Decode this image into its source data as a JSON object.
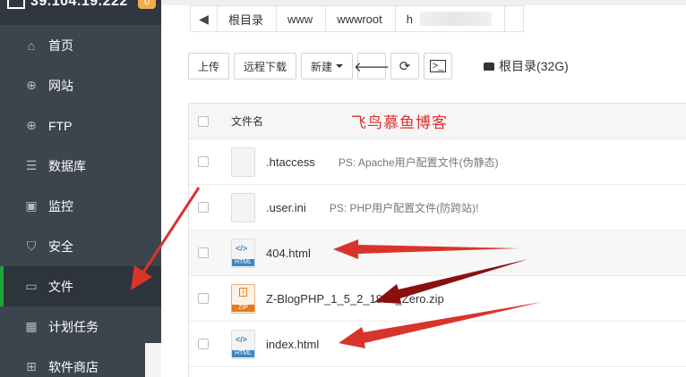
{
  "sidebar": {
    "ip": "39.104.19.222",
    "badge": "0",
    "items": [
      {
        "label": "首页",
        "icon": "⌂"
      },
      {
        "label": "网站",
        "icon": "⊕"
      },
      {
        "label": "FTP",
        "icon": "⊕"
      },
      {
        "label": "数据库",
        "icon": "☰"
      },
      {
        "label": "监控",
        "icon": "▣"
      },
      {
        "label": "安全",
        "icon": "⛉"
      },
      {
        "label": "文件",
        "icon": "▭"
      },
      {
        "label": "计划任务",
        "icon": "▦"
      },
      {
        "label": "软件商店",
        "icon": "⊞"
      }
    ]
  },
  "breadcrumb": {
    "back": "◀",
    "items": [
      "根目录",
      "www",
      "wwwroot",
      "h"
    ]
  },
  "toolbar": {
    "upload": "上传",
    "remote_download": "远程下载",
    "new": "新建",
    "back_icon": "🡐",
    "refresh_icon": "⟳",
    "terminal_icon": ">_",
    "disk_label": "根目录(32G)"
  },
  "table": {
    "header_name": "文件名",
    "watermark": "飞鸟慕鱼博客",
    "rows": [
      {
        "name": ".htaccess",
        "desc": "PS: Apache用户配置文件(伪静态)"
      },
      {
        "name": ".user.ini",
        "desc": "PS: PHP用户配置文件(防跨站)!"
      },
      {
        "name": "404.html",
        "desc": "",
        "type": "HTML"
      },
      {
        "name": "Z-BlogPHP_1_5_2_1935_Zero.zip",
        "desc": "",
        "type": "ZIP"
      },
      {
        "name": "index.html",
        "desc": "",
        "type": "HTML"
      }
    ]
  },
  "colors": {
    "sidebar_bg": "#3c444d",
    "active_accent": "#20a53a",
    "arrow_red": "#d9342b",
    "watermark_red": "#e03030"
  }
}
